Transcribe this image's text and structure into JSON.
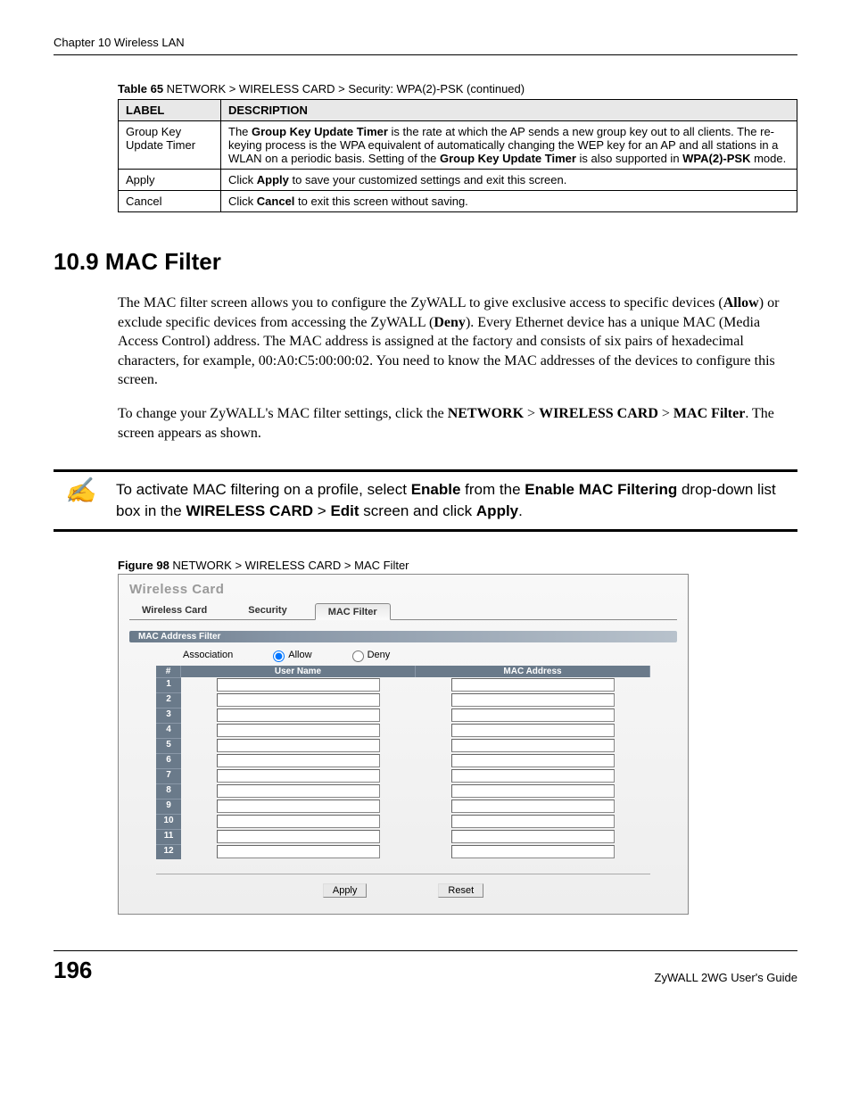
{
  "chapter_header": "Chapter 10 Wireless LAN",
  "table_caption_prefix": "Table 65",
  "table_caption_text": "   NETWORK > WIRELESS CARD > Security: WPA(2)-PSK (continued)",
  "table_headers": {
    "col1": "LABEL",
    "col2": "DESCRIPTION"
  },
  "table_rows": {
    "row1": {
      "label": "Group Key Update Timer",
      "desc_pre": "The ",
      "desc_b1": "Group Key Update Timer",
      "desc_mid": " is the rate at which the AP sends a new group key out to all clients. The re-keying process is the WPA equivalent of automatically changing the WEP key for an AP and all stations in a WLAN on a periodic basis. Setting of the ",
      "desc_b2": "Group Key Update Timer",
      "desc_mid2": " is also supported in ",
      "desc_b3": "WPA(2)-PSK",
      "desc_post": " mode."
    },
    "row2": {
      "label": "Apply",
      "desc_pre": "Click ",
      "desc_b1": "Apply",
      "desc_post": " to save your customized settings and exit this screen."
    },
    "row3": {
      "label": "Cancel",
      "desc_pre": "Click ",
      "desc_b1": "Cancel",
      "desc_post": " to exit this screen without saving."
    }
  },
  "section_heading": "10.9  MAC Filter",
  "para1_pre": "The MAC filter screen allows you to configure the ZyWALL to give exclusive access to specific devices (",
  "para1_b1": "Allow",
  "para1_mid": ") or exclude specific devices from accessing the ZyWALL (",
  "para1_b2": "Deny",
  "para1_post": "). Every Ethernet device has a unique MAC (Media Access Control) address. The MAC address is assigned at the factory and consists of six pairs of hexadecimal characters, for example, 00:A0:C5:00:00:02. You need to know the MAC addresses of the devices to configure this screen.",
  "para2_pre": "To change your ZyWALL's MAC filter settings, click the ",
  "para2_b1": "NETWORK",
  "para2_gt1": " > ",
  "para2_b2": "WIRELESS CARD",
  "para2_gt2": " > ",
  "para2_b3": "MAC Filter",
  "para2_post": ". The screen appears as shown.",
  "note_icon": "✍",
  "note_pre": "To activate MAC filtering on a profile, select ",
  "note_b1": "Enable",
  "note_mid1": " from the ",
  "note_b2": "Enable MAC Filtering",
  "note_mid2": " drop-down list box in the ",
  "note_b3": "WIRELESS CARD",
  "note_gt": " > ",
  "note_b4": "Edit",
  "note_mid3": " screen and click ",
  "note_b5": "Apply",
  "note_post": ".",
  "figure_caption_prefix": "Figure 98",
  "figure_caption_text": "   NETWORK > WIRELESS CARD > MAC Filter",
  "ss": {
    "title": "Wireless Card",
    "tabs": {
      "t1": "Wireless Card",
      "t2": "Security",
      "t3": "MAC Filter"
    },
    "section_bar": "MAC Address Filter",
    "assoc_label": "Association",
    "allow_label": "Allow",
    "deny_label": "Deny",
    "grid_head_num": "#",
    "grid_head_user": "User Name",
    "grid_head_mac": "MAC Address",
    "row_nums": {
      "r1": "1",
      "r2": "2",
      "r3": "3",
      "r4": "4",
      "r5": "5",
      "r6": "6",
      "r7": "7",
      "r8": "8",
      "r9": "9",
      "r10": "10",
      "r11": "11",
      "r12": "12"
    },
    "apply": "Apply",
    "reset": "Reset"
  },
  "page_number": "196",
  "guide_name": "ZyWALL 2WG User's Guide"
}
